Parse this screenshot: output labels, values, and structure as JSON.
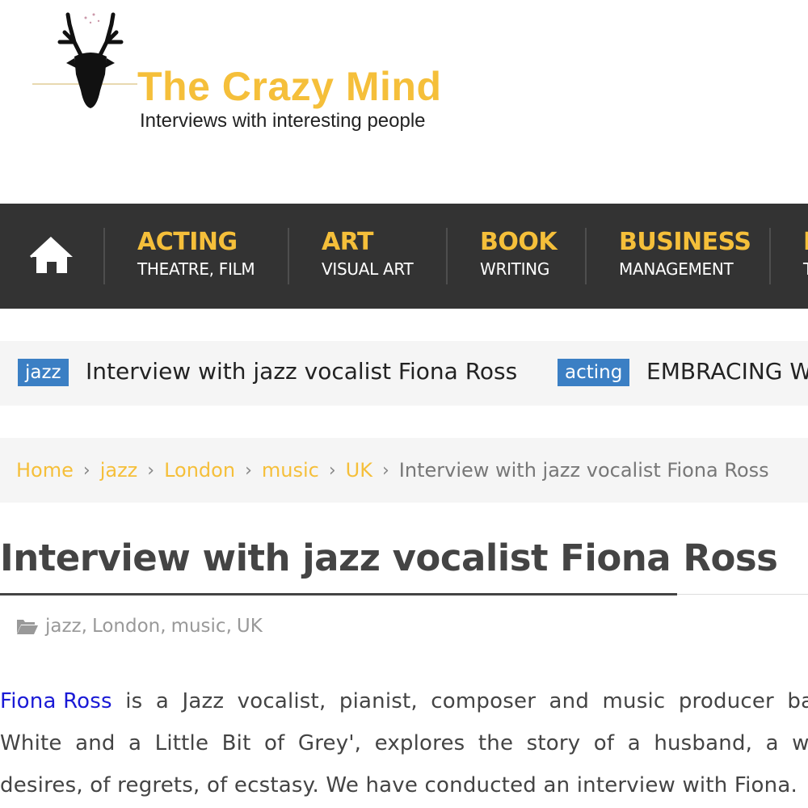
{
  "logo": {
    "title": "The Crazy Mind",
    "tagline": "Interviews with interesting people",
    "icon": "deer-head-icon"
  },
  "nav": {
    "home_icon": "home-icon",
    "items": [
      {
        "title": "ACTING",
        "subtitle": "THEATRE, FILM"
      },
      {
        "title": "ART",
        "subtitle": "VISUAL ART"
      },
      {
        "title": "BOOK",
        "subtitle": "WRITING"
      },
      {
        "title": "BUSINESS",
        "subtitle": "MANAGEMENT"
      },
      {
        "title": "F",
        "subtitle": "T"
      }
    ]
  },
  "ticker": {
    "items": [
      {
        "tag": "jazz",
        "text": "Interview with jazz vocalist Fiona Ross"
      },
      {
        "tag": "acting",
        "text": "EMBRACING WH"
      }
    ]
  },
  "breadcrumb": {
    "links": [
      "Home",
      "jazz",
      "London",
      "music",
      "UK"
    ],
    "separator": "›",
    "current": "Interview with jazz vocalist Fiona Ross"
  },
  "post": {
    "title": "Interview with jazz vocalist Fiona Ross",
    "meta_icon": "folder-open-icon",
    "categories": [
      "jazz",
      "London",
      "music",
      "UK"
    ],
    "body": {
      "link_text": "Fiona Ross",
      "line1_rest": " is a Jazz vocalist, pianist, composer and music producer base",
      "line2": "White and a Little Bit of Grey', explores the story of a husband, a wife, a",
      "line3": "desires, of regrets, of ecstasy. We have conducted an interview with Fiona."
    }
  },
  "colors": {
    "accent": "#f5bf3a",
    "nav_bg": "#333333",
    "tag_bg": "#3b7fc4",
    "link": "#1a1ad6"
  }
}
